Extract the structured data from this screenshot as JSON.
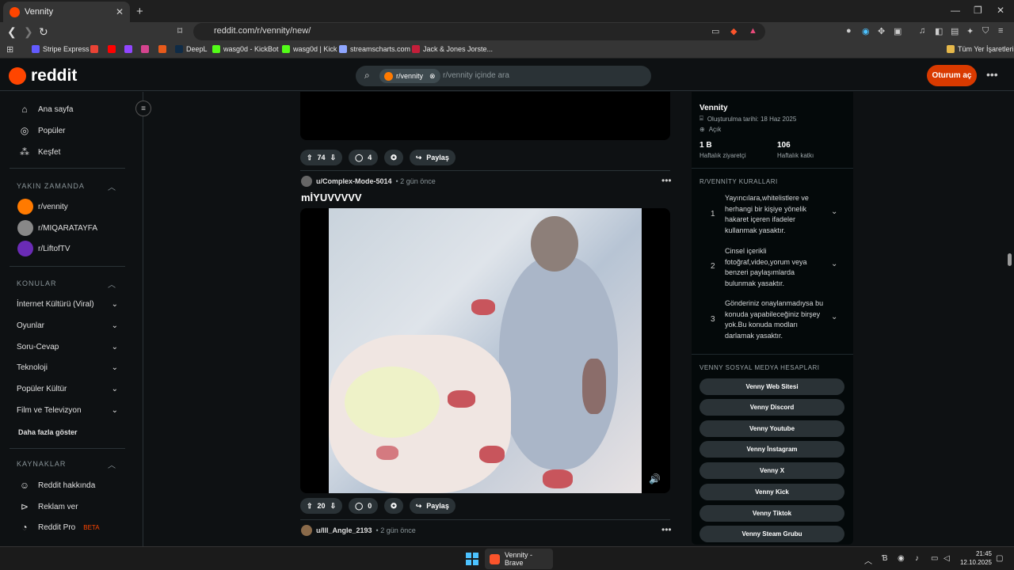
{
  "browser": {
    "tab_title": "Vennity",
    "new_tab": "+",
    "url": "reddit.com/r/vennity/new/",
    "bookmarks": [
      "Stripe Express",
      "DeepL",
      "wasg0d - KickBot",
      "wasg0d | Kick",
      "streamscharts.com",
      "Jack & Jones Jorste...",
      "Tüm Yer İşaretleri"
    ]
  },
  "header": {
    "logo": "reddit",
    "search_chip": "r/vennity",
    "search_placeholder": "r/vennity içinde ara",
    "login": "Oturum aç",
    "more": "•••"
  },
  "sidebar": {
    "nav": [
      "Ana sayfa",
      "Popüler",
      "Keşfet"
    ],
    "recent_title": "YAKIN ZAMANDA",
    "recent": [
      "r/vennity",
      "r/MIQARATAYFA",
      "r/LiftofTV"
    ],
    "topics_title": "KONULAR",
    "topics": [
      "İnternet Kültürü (Viral)",
      "Oyunlar",
      "Soru-Cevap",
      "Teknoloji",
      "Popüler Kültür",
      "Film ve Televizyon"
    ],
    "more": "Daha fazla göster",
    "resources_title": "KAYNAKLAR",
    "resources": [
      "Reddit hakkında",
      "Reklam ver",
      "Reddit Pro"
    ],
    "beta": "BETA"
  },
  "feed": {
    "post1": {
      "votes": "74",
      "comments": "4",
      "share": "Paylaş"
    },
    "post2": {
      "user": "u/Complex-Mode-5014",
      "time": "• 2 gün önce",
      "title": "mİYUVVVVV",
      "votes": "20",
      "comments": "0",
      "share": "Paylaş"
    },
    "post3": {
      "user": "u/Ill_Angle_2193",
      "time": "• 2 gün önce"
    }
  },
  "community": {
    "name": "Vennity",
    "created": "Oluşturulma tarihi: 18 Haz 2025",
    "visibility": "Açık",
    "visitors_value": "1 B",
    "visitors_label": "Haftalık ziyaretçi",
    "contrib_value": "106",
    "contrib_label": "Haftalık katkı",
    "rules_title": "R/VENNİTY KURALLARI",
    "rules": [
      "Yayıncılara,whitelistlere ve herhangi bir kişiye yönelik hakaret içeren ifadeler kullanmak yasaktır.",
      "Cinsel içerikli fotoğraf,video,yorum veya benzeri paylaşımlarda bulunmak yasaktır.",
      "Gönderiniz onaylanmadıysa bu konuda yapabileceğiniz birşey yok.Bu konuda modları darlamak yasaktır."
    ],
    "social_title": "VENNY SOSYAL MEDYA HESAPLARI",
    "social": [
      "Venny Web Sitesi",
      "Venny Discord",
      "Venny Youtube",
      "Venny İnstagram",
      "Venny X",
      "Venny Kick",
      "Venny Tiktok",
      "Venny Steam Grubu"
    ]
  },
  "taskbar": {
    "app": "Vennity - Brave",
    "time": "21:45",
    "date": "12.10.2025"
  }
}
